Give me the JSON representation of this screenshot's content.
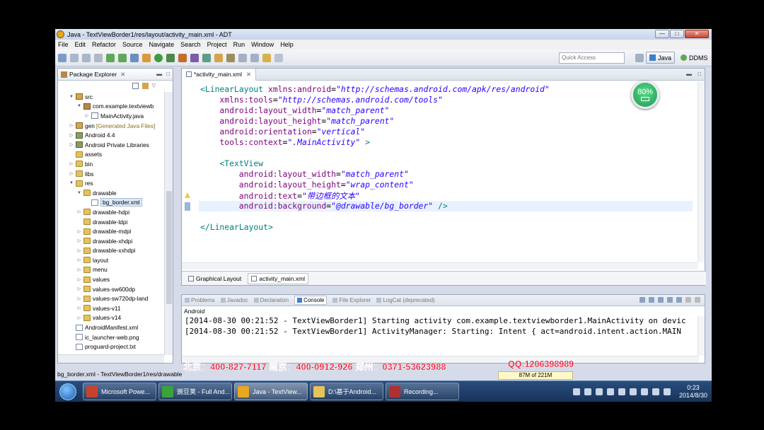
{
  "window": {
    "title": "Java - TextViewBorder1/res/layout/activity_main.xml - ADT",
    "controls": [
      "—",
      "□",
      "✕"
    ]
  },
  "menu": [
    "File",
    "Edit",
    "Refactor",
    "Source",
    "Navigate",
    "Search",
    "Project",
    "Run",
    "Window",
    "Help"
  ],
  "toolbar": {
    "quick_access_placeholder": "Quick Access",
    "perspectives": [
      "Java",
      "DDMS"
    ]
  },
  "package_explorer": {
    "title": "Package Explorer",
    "items": [
      {
        "label": "src",
        "indent": 1,
        "twisty": "▼",
        "icon": "src"
      },
      {
        "label": "com.example.textviewb",
        "indent": 2,
        "twisty": "▼",
        "icon": "pkg"
      },
      {
        "label": "MainActivity.java",
        "indent": 3,
        "twisty": "▷",
        "icon": "java"
      },
      {
        "label": "gen",
        "extra": "[Generated Java Files]",
        "indent": 1,
        "twisty": "▷",
        "icon": "src"
      },
      {
        "label": "Android 4.4",
        "indent": 1,
        "twisty": "▷",
        "icon": "lib"
      },
      {
        "label": "Android Private Libraries",
        "indent": 1,
        "twisty": "▷",
        "icon": "lib"
      },
      {
        "label": "assets",
        "indent": 1,
        "twisty": "",
        "icon": "folder"
      },
      {
        "label": "bin",
        "indent": 1,
        "twisty": "▷",
        "icon": "folder"
      },
      {
        "label": "libs",
        "indent": 1,
        "twisty": "▷",
        "icon": "folder"
      },
      {
        "label": "res",
        "indent": 1,
        "twisty": "▼",
        "icon": "folder"
      },
      {
        "label": "drawable",
        "indent": 2,
        "twisty": "▼",
        "icon": "folder"
      },
      {
        "label": "bg_border.xml",
        "indent": 3,
        "twisty": "",
        "icon": "file",
        "selected": true
      },
      {
        "label": "drawable-hdpi",
        "indent": 2,
        "twisty": "▷",
        "icon": "folder"
      },
      {
        "label": "drawable-ldpi",
        "indent": 2,
        "twisty": "",
        "icon": "folder"
      },
      {
        "label": "drawable-mdpi",
        "indent": 2,
        "twisty": "▷",
        "icon": "folder"
      },
      {
        "label": "drawable-xhdpi",
        "indent": 2,
        "twisty": "▷",
        "icon": "folder"
      },
      {
        "label": "drawable-xxhdpi",
        "indent": 2,
        "twisty": "▷",
        "icon": "folder"
      },
      {
        "label": "layout",
        "indent": 2,
        "twisty": "▷",
        "icon": "folder"
      },
      {
        "label": "menu",
        "indent": 2,
        "twisty": "▷",
        "icon": "folder"
      },
      {
        "label": "values",
        "indent": 2,
        "twisty": "▷",
        "icon": "folder"
      },
      {
        "label": "values-sw600dp",
        "indent": 2,
        "twisty": "▷",
        "icon": "folder"
      },
      {
        "label": "values-sw720dp-land",
        "indent": 2,
        "twisty": "▷",
        "icon": "folder"
      },
      {
        "label": "values-v11",
        "indent": 2,
        "twisty": "▷",
        "icon": "folder"
      },
      {
        "label": "values-v14",
        "indent": 2,
        "twisty": "▷",
        "icon": "folder"
      },
      {
        "label": "AndroidManifest.xml",
        "indent": 1,
        "twisty": "",
        "icon": "file"
      },
      {
        "label": "ic_launcher-web.png",
        "indent": 1,
        "twisty": "",
        "icon": "file"
      },
      {
        "label": "proguard-project.txt",
        "indent": 1,
        "twisty": "",
        "icon": "file"
      }
    ]
  },
  "editor": {
    "tab_label": "*activity_main.xml",
    "lines": [
      {
        "indent": 0,
        "tokens": [
          [
            "tag",
            "<LinearLayout "
          ],
          [
            "attr",
            "xmlns:android"
          ],
          [
            "plain",
            "="
          ],
          [
            "val",
            "\"http://schemas.android.com/apk/res/android\""
          ]
        ]
      },
      {
        "indent": 4,
        "tokens": [
          [
            "attr",
            "xmlns:tools"
          ],
          [
            "plain",
            "="
          ],
          [
            "val",
            "\"http://schemas.android.com/tools\""
          ]
        ]
      },
      {
        "indent": 4,
        "tokens": [
          [
            "attr",
            "android:layout_width"
          ],
          [
            "plain",
            "="
          ],
          [
            "val",
            "\"match_parent\""
          ]
        ]
      },
      {
        "indent": 4,
        "tokens": [
          [
            "attr",
            "android:layout_height"
          ],
          [
            "plain",
            "="
          ],
          [
            "val",
            "\"match_parent\""
          ]
        ]
      },
      {
        "indent": 4,
        "tokens": [
          [
            "attr",
            "android:orientation"
          ],
          [
            "plain",
            "="
          ],
          [
            "val",
            "\"vertical\""
          ]
        ]
      },
      {
        "indent": 4,
        "tokens": [
          [
            "attr",
            "tools:context"
          ],
          [
            "plain",
            "="
          ],
          [
            "val",
            "\".MainActivity\""
          ],
          [
            "tag",
            " >"
          ]
        ]
      },
      {
        "indent": 0,
        "tokens": []
      },
      {
        "indent": 4,
        "tokens": [
          [
            "tag",
            "<TextView"
          ]
        ]
      },
      {
        "indent": 8,
        "tokens": [
          [
            "attr",
            "android:layout_width"
          ],
          [
            "plain",
            "="
          ],
          [
            "val",
            "\"match_parent\""
          ]
        ]
      },
      {
        "indent": 8,
        "tokens": [
          [
            "attr",
            "android:layout_height"
          ],
          [
            "plain",
            "="
          ],
          [
            "val",
            "\"wrap_content\""
          ]
        ]
      },
      {
        "indent": 8,
        "tokens": [
          [
            "attr",
            "android:text"
          ],
          [
            "plain",
            "="
          ],
          [
            "val",
            "\"带边框的文本\""
          ]
        ]
      },
      {
        "indent": 8,
        "tokens": [
          [
            "attr",
            "android:background"
          ],
          [
            "plain",
            "="
          ],
          [
            "val",
            "\"@drawable/bg_border\""
          ],
          [
            "tag",
            " />"
          ]
        ],
        "highlight": true
      },
      {
        "indent": 0,
        "tokens": []
      },
      {
        "indent": 0,
        "tokens": [
          [
            "tag",
            "</LinearLayout>"
          ]
        ]
      }
    ],
    "bottom_tabs": [
      "Graphical Layout",
      "activity_main.xml"
    ]
  },
  "battery_badge": {
    "text": "80%"
  },
  "console": {
    "tabs": [
      {
        "label": "Problems",
        "active": false
      },
      {
        "label": "Javadoc",
        "active": false
      },
      {
        "label": "Declaration",
        "active": false
      },
      {
        "label": "Console",
        "active": true
      },
      {
        "label": "File Explorer",
        "active": false
      },
      {
        "label": "LogCat (deprecated)",
        "active": false
      }
    ],
    "label": "Android",
    "lines": [
      "[2014-08-30 00:21:52 - TextViewBorder1] Starting activity com.example.textviewborder1.MainActivity on devic",
      "[2014-08-30 00:21:52 - TextViewBorder1] ActivityManager: Starting: Intent { act=android.intent.action.MAIN"
    ]
  },
  "status": {
    "path": "bg_border.xml - TextViewBorder1/res/drawable",
    "heap": "87M of 221M"
  },
  "overlay": {
    "phones": "北京：400-827-7117 南京：400-0912-926 郑州：0371-53623988",
    "qq": "QQ:1206398989"
  },
  "taskbar": {
    "items": [
      {
        "label": "Microsoft Powe...",
        "color": "#c8432e"
      },
      {
        "label": "豌豆荚 - Full And...",
        "color": "#3aa33a"
      },
      {
        "label": "Java - TextView...",
        "color": "#e7a71f",
        "active": true
      },
      {
        "label": "D:\\基于Android...",
        "color": "#e6c35a"
      },
      {
        "label": "Recording...",
        "color": "#b03030"
      }
    ],
    "time": "0:23",
    "date": "2014/8/30"
  }
}
